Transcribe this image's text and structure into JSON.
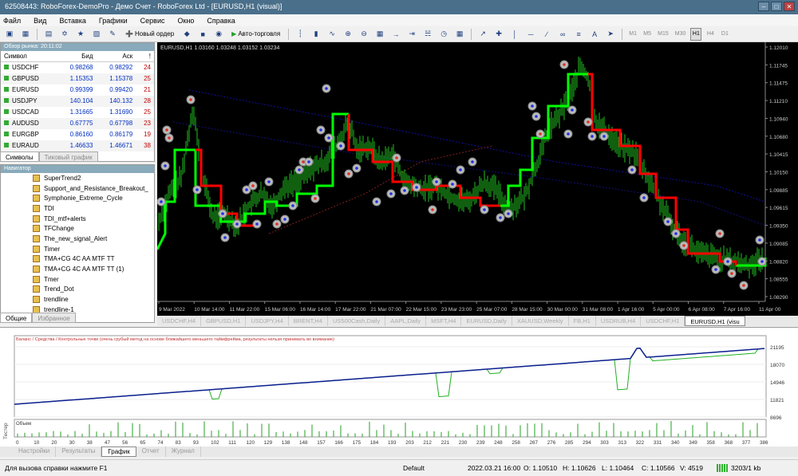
{
  "titlebar": {
    "title": "62508443: RoboForex-DemoPro - Демо Счет - RoboForex Ltd - [EURUSD,H1 (visual)]"
  },
  "menu": [
    "Файл",
    "Вид",
    "Вставка",
    "Графики",
    "Сервис",
    "Окно",
    "Справка"
  ],
  "toolbar": {
    "new_order": "Новый ордер",
    "autotrading": "Авто-торговля",
    "timeframes": [
      "M1",
      "M5",
      "M15",
      "M30",
      "H1",
      "H4",
      "D1"
    ],
    "active_tf": "H1"
  },
  "market_watch": {
    "header": "Обзор рынка: 20:11:02",
    "columns": [
      "Символ",
      "Бид",
      "Аск",
      "!"
    ],
    "rows": [
      {
        "symbol": "USDCHF",
        "bid": "0.98268",
        "ask": "0.98292",
        "spread": "24"
      },
      {
        "symbol": "GBPUSD",
        "bid": "1.15353",
        "ask": "1.15378",
        "spread": "25"
      },
      {
        "symbol": "EURUSD",
        "bid": "0.99399",
        "ask": "0.99420",
        "spread": "21"
      },
      {
        "symbol": "USDJPY",
        "bid": "140.104",
        "ask": "140.132",
        "spread": "28"
      },
      {
        "symbol": "USDCAD",
        "bid": "1.31665",
        "ask": "1.31690",
        "spread": "25"
      },
      {
        "symbol": "AUDUSD",
        "bid": "0.67775",
        "ask": "0.67798",
        "spread": "23"
      },
      {
        "symbol": "EURGBP",
        "bid": "0.86160",
        "ask": "0.86179",
        "spread": "19"
      },
      {
        "symbol": "EURAUD",
        "bid": "1.46633",
        "ask": "1.46671",
        "spread": "38"
      }
    ],
    "tabs": [
      "Символы",
      "Тиковый график"
    ]
  },
  "navigator": {
    "header": "Навигатор",
    "items": [
      "SuperTrend2",
      "Support_and_Resistance_Breakout_",
      "Symphonie_Extreme_Cycle",
      "TDI",
      "TDI_mtf+alerts",
      "TFChange",
      "The_new_signal_Alert",
      "Timer",
      "TMA+CG 4C AA MTF TT",
      "TMA+CG 4C AA MTF TT (1)",
      "Tmer",
      "Trend_Dot",
      "trendline",
      "trendline-1"
    ],
    "tabs": [
      "Общие",
      "Избранное"
    ]
  },
  "chart": {
    "header": "EURUSD,H1  1.03160 1.03248 1.03152 1.03234",
    "price_labels": [
      "1.12010",
      "1.11745",
      "1.11475",
      "1.11210",
      "1.10940",
      "1.10680",
      "1.10415",
      "1.10150",
      "1.09885",
      "1.09615",
      "1.09350",
      "1.09085",
      "1.08820",
      "1.08555",
      "1.08290"
    ],
    "time_labels": [
      "9 Mar 2022",
      "10 Mar 14:00",
      "11 Mar 22:00",
      "15 Mar 06:00",
      "16 Mar 14:00",
      "17 Mar 22:00",
      "21 Mar 07:00",
      "22 Mar 15:00",
      "23 Mar 23:00",
      "25 Mar 07:00",
      "28 Mar 15:00",
      "30 Mar 00:00",
      "31 Mar 08:00",
      "1 Apr 16:00",
      "5 Apr 00:00",
      "6 Apr 08:00",
      "7 Apr 16:00",
      "11 Apr 00"
    ]
  },
  "chart_tabs": [
    "USDCHF,H4",
    "GBPUSD,H1",
    "USDJPY,H4",
    "BRENT,H4",
    "US500Cash,Daily",
    "AAPL,Daily",
    "MSFT,H4",
    "EURUSD,Daily",
    "XAUUSD,Weekly",
    "FB,H1",
    "USDRUB,H4",
    "USDCHF,H1",
    "EURUSD,H1 (visu"
  ],
  "tester": {
    "legend": "Баланс / Средства / Контрольные точки (очень грубый метод на основе ближайшего меньшего таймфрейма, результаты нельзя принимать во внимание)",
    "volume_label": "Объем",
    "y_labels": [
      "21195",
      "18070",
      "14946",
      "11821",
      "8696"
    ],
    "x_labels": [
      "0",
      "10",
      "20",
      "30",
      "38",
      "47",
      "56",
      "65",
      "74",
      "83",
      "93",
      "102",
      "111",
      "120",
      "129",
      "138",
      "148",
      "157",
      "166",
      "175",
      "184",
      "193",
      "203",
      "212",
      "221",
      "230",
      "239",
      "248",
      "258",
      "267",
      "276",
      "285",
      "294",
      "303",
      "313",
      "322",
      "331",
      "340",
      "349",
      "358",
      "368",
      "377",
      "386"
    ],
    "side_label": "Тестер",
    "tabs": [
      "Настройки",
      "Результаты",
      "График",
      "Отчет",
      "Журнал"
    ]
  },
  "status": {
    "help": "Для вызова справки нажмите F1",
    "profile": "Default",
    "datetime": "2022.03.21 16:00",
    "open": "O: 1.10510",
    "high": "H: 1.10626",
    "low": "L: 1.10464",
    "close": "C: 1.10566",
    "volume": "V: 4519",
    "traffic": "3203/1 kb"
  },
  "colors": {
    "balance": "#0b1f8f",
    "equity": "#20b020",
    "supertrend_up": "#00ff00",
    "supertrend_down": "#ff0000",
    "bull": "#20c020"
  }
}
